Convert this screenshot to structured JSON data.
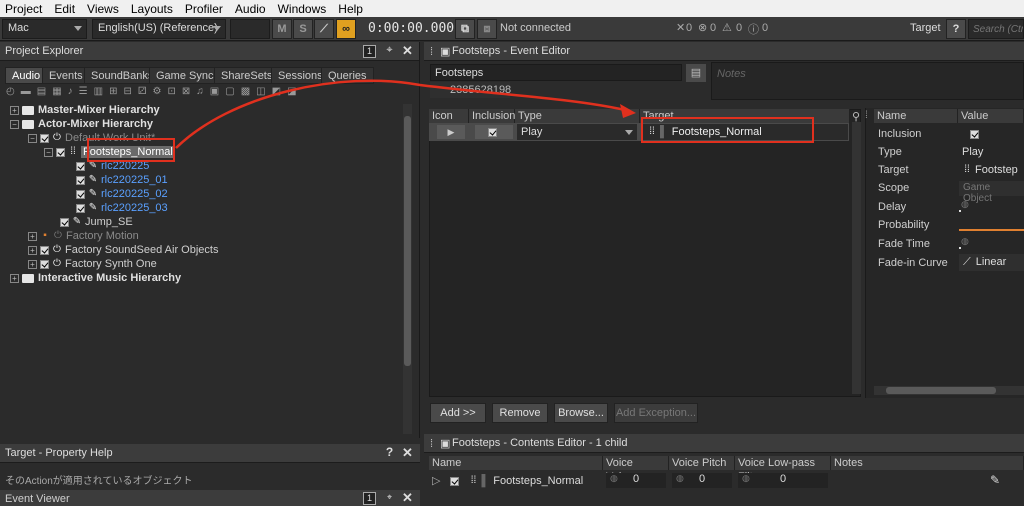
{
  "menu": [
    "Project",
    "Edit",
    "Views",
    "Layouts",
    "Profiler",
    "Audio",
    "Windows",
    "Help"
  ],
  "toolbar": {
    "platform": "Mac",
    "language": "English(US) (Reference)",
    "btn_m": "M",
    "btn_s": "S",
    "timecode": "0:00:00.000",
    "connection": "Not connected",
    "count_x": "0",
    "count_err": "0",
    "count_warn": "0",
    "count_info": "0",
    "target_label": "Target",
    "help": "?",
    "search_placeholder": "Search (Ctrl"
  },
  "project_explorer": {
    "title": "Project Explorer",
    "tab_index": "1",
    "tabs": [
      "Audio",
      "Events",
      "SoundBanks",
      "Game Syncs",
      "ShareSets",
      "Sessions",
      "Queries"
    ],
    "tree": [
      {
        "label": "Master-Mixer Hierarchy",
        "style": "bold"
      },
      {
        "label": "Actor-Mixer Hierarchy",
        "style": "bold"
      },
      {
        "label": "Default Work Unit*",
        "style": "dim"
      },
      {
        "label": "Footsteps_Normal",
        "style": "sel"
      },
      {
        "label": "rlc220225",
        "style": "blue"
      },
      {
        "label": "rlc220225_01",
        "style": "blue"
      },
      {
        "label": "rlc220225_02",
        "style": "blue"
      },
      {
        "label": "rlc220225_03",
        "style": "blue"
      },
      {
        "label": "Jump_SE",
        "style": "normal"
      },
      {
        "label": "Factory Motion",
        "style": "dim"
      },
      {
        "label": "Factory SoundSeed Air Objects",
        "style": "normal"
      },
      {
        "label": "Factory Synth One",
        "style": "normal"
      },
      {
        "label": "Interactive Music Hierarchy",
        "style": "bold"
      }
    ]
  },
  "property_help": {
    "title": "Target - Property Help",
    "help": "?",
    "text": "そのActionが適用されているオブジェクト"
  },
  "event_viewer": {
    "title": "Event Viewer",
    "tab_index": "1"
  },
  "event_editor": {
    "title": "Footsteps - Event Editor",
    "name_value": "Footsteps",
    "id_value": "2385628198",
    "notes_placeholder": "Notes",
    "columns": [
      "Icon",
      "Inclusion",
      "Type",
      "Target"
    ],
    "row": {
      "type": "Play",
      "target": "Footsteps_Normal"
    },
    "buttons": {
      "add": "Add >>",
      "remove": "Remove",
      "browse": "Browse...",
      "add_exception": "Add Exception..."
    }
  },
  "properties": {
    "columns": [
      "Name",
      "Value"
    ],
    "rows": [
      {
        "name": "Inclusion",
        "value": ""
      },
      {
        "name": "Type",
        "value": "Play"
      },
      {
        "name": "Target",
        "value": "Footstep"
      },
      {
        "name": "Scope",
        "value": "Game Object"
      },
      {
        "name": "Delay",
        "value": ""
      },
      {
        "name": "Probability",
        "value": ""
      },
      {
        "name": "Fade Time",
        "value": ""
      },
      {
        "name": "Fade-in Curve",
        "value": "Linear"
      }
    ]
  },
  "contents_editor": {
    "title": "Footsteps - Contents Editor - 1 child",
    "columns": [
      "Name",
      "Voice Volume",
      "Voice Pitch",
      "Voice Low-pass Filter",
      "Notes"
    ],
    "row": {
      "name": "Footsteps_Normal",
      "volume": "0",
      "pitch": "0",
      "lpf": "0"
    }
  },
  "colors": {
    "accent": "#e0301e",
    "link": "#5aa0ff",
    "selection": "#6a6a6a"
  }
}
